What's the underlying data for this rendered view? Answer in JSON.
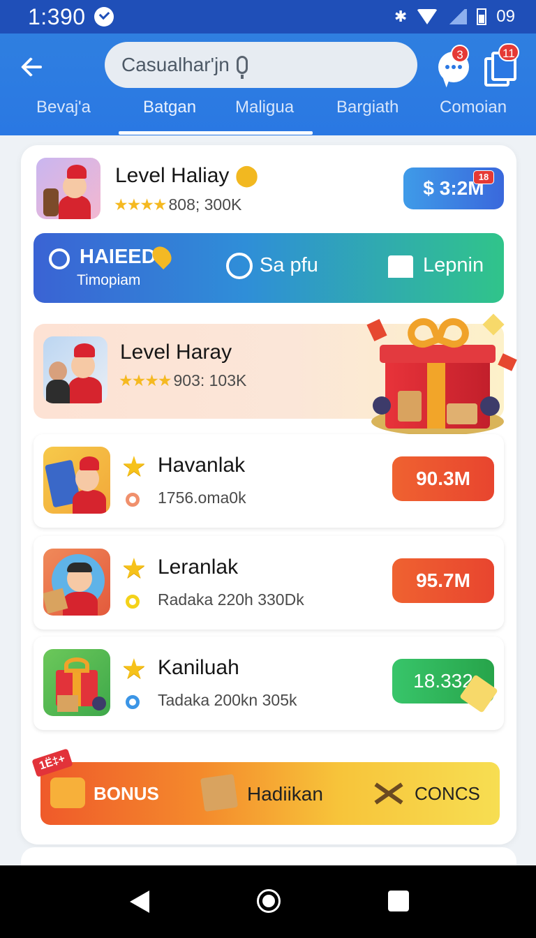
{
  "status_bar": {
    "time": "1:390",
    "bt": "✱",
    "right_text": "09"
  },
  "header": {
    "search_text": "Casualhar'jn",
    "chat_badge": "3",
    "copy_badge": "11",
    "tabs": [
      "Bevaj'a",
      "Batgan",
      "Maligua",
      "Bargiath",
      "Comoian"
    ],
    "active_tab": "Batgan"
  },
  "top_item": {
    "title": "Level Haliay",
    "rating": "808; 300K",
    "price": "$ 3:2M",
    "price_badge": "18"
  },
  "promo": {
    "haieed": "HAIEED",
    "timopiam": "Timopiam",
    "sapfu": "Sa pfu",
    "lepnin": "Lepnin"
  },
  "featured": {
    "title": "Level Haray",
    "rating": "903: 103K"
  },
  "rows": [
    {
      "title": "Havanlak",
      "sub": "1756.oma0k",
      "price": "90.3M",
      "dot_color": "#f0906c"
    },
    {
      "title": "Leranlak",
      "sub": "Radaka 220h 330Dk",
      "price": "95.7M",
      "dot_color": "#f4d21a"
    },
    {
      "title": "Kaniluah",
      "sub": "Tadaka 200kn 305k",
      "price": "18.332",
      "dot_color": "#3b95e6"
    }
  ],
  "bonus": {
    "ribbon": "1Ë‡+",
    "bonus": "BONUS",
    "hadiikan": "Hadiikan",
    "concs": "CONCS"
  },
  "colors": {
    "header_blue": "#2a78e3",
    "orange_pill": "#ef5a2a",
    "green_pill": "#2fbf5a",
    "blue_pill": "#3a7fe0"
  }
}
